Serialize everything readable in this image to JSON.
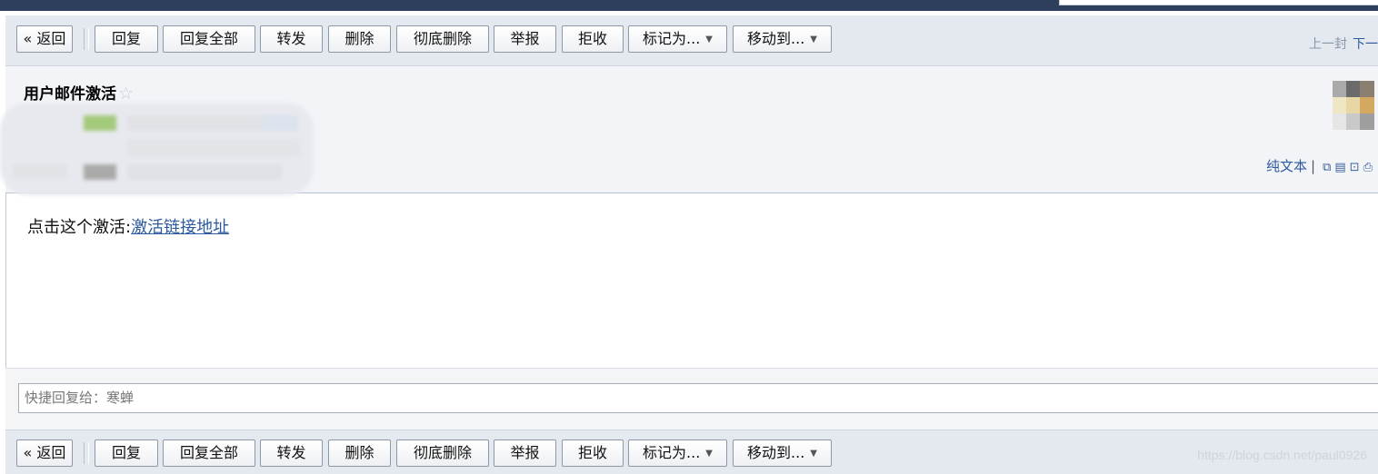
{
  "toolbar": {
    "back": "« 返回",
    "reply": "回复",
    "reply_all": "回复全部",
    "forward": "转发",
    "delete": "删除",
    "delete_forever": "彻底删除",
    "report": "举报",
    "reject": "拒收",
    "mark_as": "标记为...",
    "move_to": "移动到...",
    "prev": "上一封",
    "next": "下一"
  },
  "message": {
    "subject": "用户邮件激活",
    "star_icon": "star-outline-icon",
    "plain_text": "纯文本",
    "header_icons": [
      "new-window-icon",
      "note-icon",
      "download-icon",
      "print-icon"
    ],
    "body_prefix": "点击这个激活:",
    "body_link": "激活链接地址"
  },
  "quick_reply": {
    "placeholder": "快捷回复给：寒蝉"
  },
  "watermark": "https://blog.csdn.net/paul0926",
  "colors": {
    "top_bar": "#2d3f5c",
    "toolbar_bg": "#e4e8ef",
    "header_bg": "#f2f4f8",
    "link": "#2d5a9e"
  }
}
